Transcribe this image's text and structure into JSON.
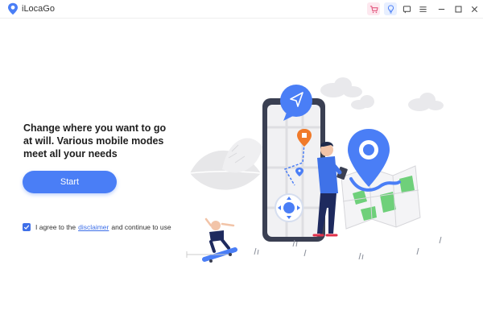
{
  "app": {
    "title": "iLocaGo"
  },
  "titlebar": {
    "icons": [
      "cart-icon",
      "lightbulb-icon",
      "feedback-icon",
      "menu-icon",
      "minimize-icon",
      "maximize-icon",
      "close-icon"
    ]
  },
  "main": {
    "headline": "Change where you want to go at will. Various mobile modes meet all your needs",
    "start_label": "Start",
    "agree_prefix": "I agree to the",
    "disclaimer_label": "disclaimer",
    "agree_suffix": "and continue to use",
    "agree_checked": true
  },
  "colors": {
    "accent": "#4a7ef6",
    "pin": "#4a7ef6",
    "map_green": "#6fd07a",
    "orange_marker": "#f07a2a"
  }
}
